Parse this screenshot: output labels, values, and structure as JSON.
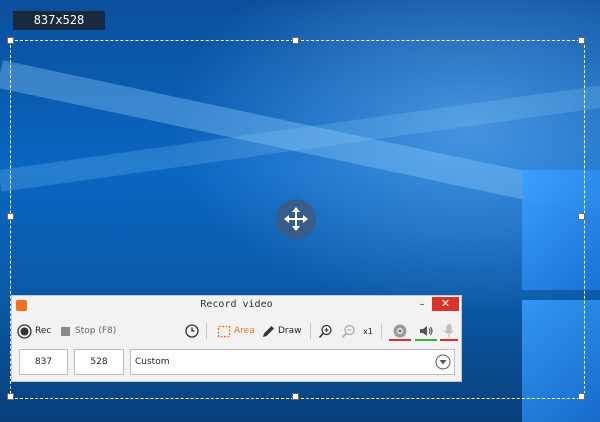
{
  "overlay": {
    "size_label": "837x528"
  },
  "recorder": {
    "title": "Record video",
    "window_controls": {
      "minimize": "–",
      "close": "✕"
    },
    "toolbar": {
      "rec_label": "Rec",
      "stop_label": "Stop (F8)",
      "area_label": "Area",
      "draw_label": "Draw",
      "zoom_label": "x1"
    },
    "dimensions": {
      "width": "837",
      "height": "528",
      "preset": "Custom"
    },
    "colors": {
      "accent": "#f07020",
      "webcam_indicator": "#d9332b",
      "speaker_indicator": "#3cae3c",
      "mic_indicator": "#d9332b",
      "close_button": "#d9332b"
    },
    "icons": [
      "record-icon",
      "stop-icon",
      "timer-icon",
      "area-icon",
      "draw-icon",
      "zoom-in-icon",
      "zoom-out-icon",
      "webcam-icon",
      "speaker-icon",
      "microphone-icon",
      "dropdown-arrow-icon",
      "move-icon"
    ]
  }
}
